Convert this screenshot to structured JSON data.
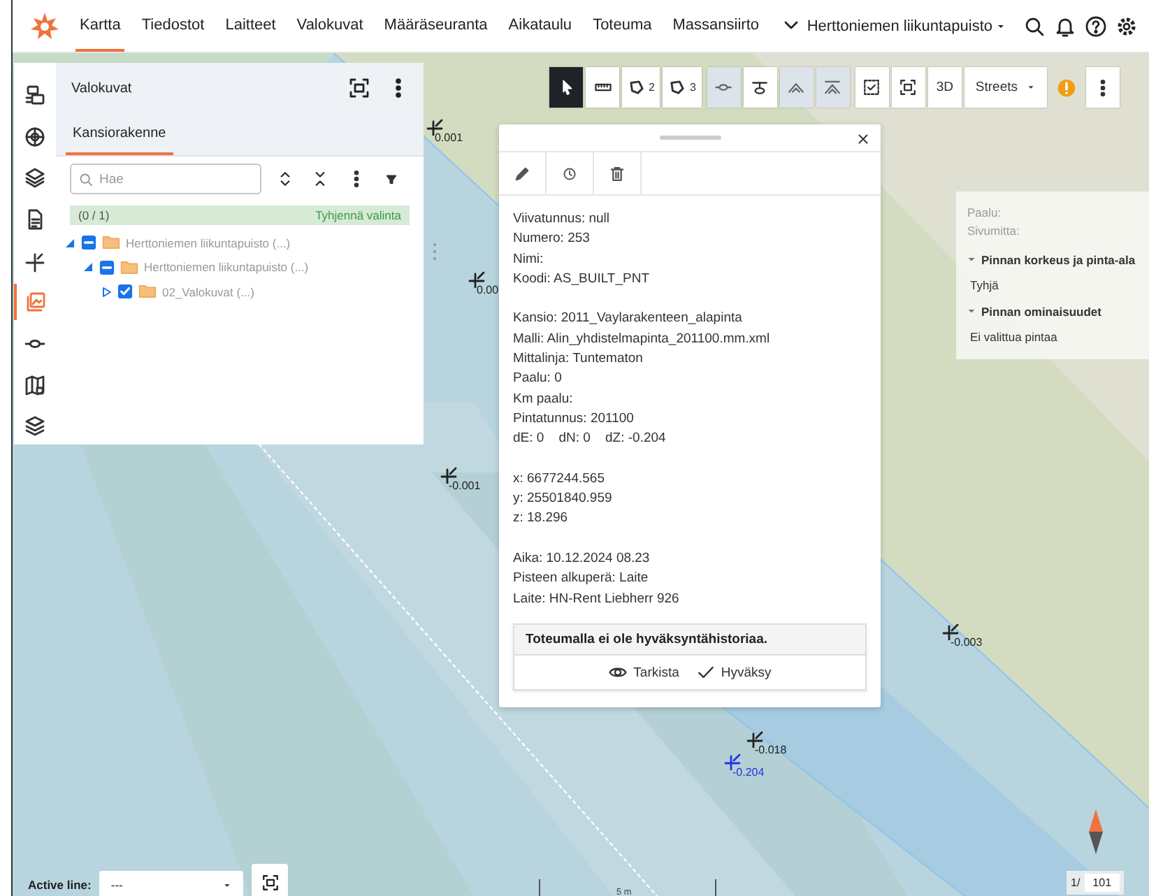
{
  "nav": {
    "items": [
      {
        "label": "Kartta",
        "selected": true
      },
      {
        "label": "Tiedostot",
        "selected": false
      },
      {
        "label": "Laitteet",
        "selected": false
      },
      {
        "label": "Valokuvat",
        "selected": false
      },
      {
        "label": "Määräseuranta",
        "selected": false
      },
      {
        "label": "Aikataulu",
        "selected": false
      },
      {
        "label": "Toteuma",
        "selected": false
      },
      {
        "label": "Massansiirto",
        "selected": false
      }
    ],
    "project": "Herttoniemen liikuntapuisto"
  },
  "rail": [
    {
      "kind": "device",
      "selected": false
    },
    {
      "kind": "cube",
      "selected": false
    },
    {
      "kind": "layers",
      "selected": false
    },
    {
      "kind": "document",
      "selected": false
    },
    {
      "kind": "point",
      "selected": false
    },
    {
      "kind": "images",
      "selected": true
    },
    {
      "kind": "line",
      "selected": false
    },
    {
      "kind": "map",
      "selected": false
    },
    {
      "kind": "stack",
      "selected": false
    }
  ],
  "panel": {
    "title": "Valokuvat",
    "tabs": [
      {
        "label": "Kansiorakenne",
        "selected": true
      }
    ],
    "search": {
      "placeholder": "Hae"
    },
    "selection": {
      "count": "(0 / 1)",
      "clear": "Tyhjennä valinta"
    },
    "tree": [
      {
        "label": "Herttoniemen liikuntapuisto (...)",
        "checked": false,
        "partial": true,
        "expanded": true,
        "children": [
          {
            "label": "Herttoniemen liikuntapuisto (...)",
            "checked": false,
            "partial": true,
            "expanded": true,
            "children": [
              {
                "label": "02_Valokuvat (...)",
                "checked": true,
                "partial": false,
                "expanded": false
              }
            ]
          }
        ]
      }
    ]
  },
  "toolbar": {
    "draw_tools": [
      {
        "kind": "select",
        "selected": true
      },
      {
        "kind": "measure",
        "selected": false
      },
      {
        "kind": "polygon",
        "badge": "2",
        "selected": false
      },
      {
        "kind": "polygon",
        "badge": "3",
        "selected": false
      }
    ],
    "line_tools": [
      {
        "kind": "line-cross",
        "disabled": true
      },
      {
        "kind": "line-bar",
        "disabled": false
      },
      {
        "kind": "line-peak",
        "disabled": true
      },
      {
        "kind": "line-peak-bar",
        "disabled": true
      }
    ],
    "view_3d": "3D",
    "basemap": "Streets"
  },
  "dialog": {
    "groups": [
      {
        "lines": [
          "Viivatunnus: null",
          "Numero: 253",
          "Nimi:",
          "Koodi: AS_BUILT_PNT"
        ]
      },
      {
        "lines": [
          "Kansio: 2011_Vaylarakenteen_alapinta",
          "Malli: Alin_yhdistelmapinta_201100.mm.xml",
          "Mittalinja: Tuntematon",
          "Paalu: 0",
          "Km paalu:",
          "Pintatunnus: 201100",
          "dE: 0    dN: 0    dZ: -0.204"
        ]
      },
      {
        "lines": [
          "x: 6677244.565",
          "y: 25501840.959",
          "z: 18.296"
        ]
      },
      {
        "lines": [
          "Aika: 10.12.2024 08.23",
          "Pisteen alkuperä: Laite",
          "Laite: HN-Rent Liebherr 926"
        ]
      }
    ],
    "approval": {
      "message": "Toteumalla ei ole hyväksyntähistoriaa.",
      "actions": [
        {
          "kind": "inspect",
          "label": "Tarkista"
        },
        {
          "kind": "approve",
          "label": "Hyväksy"
        }
      ]
    }
  },
  "info": {
    "rows": [
      "Paalu:",
      "Sivumitta:"
    ],
    "sections": [
      {
        "title": "Pinnan korkeus ja pinta-ala",
        "expanded": true,
        "body": "Tyhjä"
      },
      {
        "title": "Pinnan ominaisuudet",
        "expanded": true,
        "body": "Ei valittua pintaa"
      }
    ]
  },
  "map": {
    "points": [
      {
        "value": "0.001",
        "selected": false
      },
      {
        "value": "0.00",
        "selected": false
      },
      {
        "value": "-0.001",
        "selected": false
      },
      {
        "value": "-0.003",
        "selected": false
      },
      {
        "value": "-0.018",
        "selected": false
      },
      {
        "value": "-0.204",
        "selected": true
      }
    ],
    "scale": "5 m",
    "page": "1/",
    "page_total": "101"
  },
  "active_line": {
    "label": "Active line:",
    "value": "---"
  }
}
